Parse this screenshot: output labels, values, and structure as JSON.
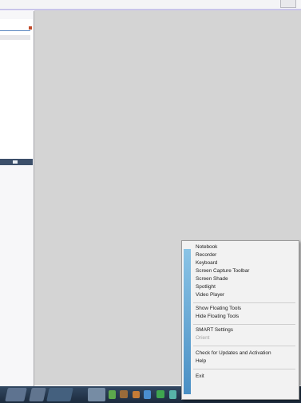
{
  "menu": {
    "group1": [
      "Notebook",
      "Recorder",
      "Keyboard",
      "Screen Capture Toolbar",
      "Screen Shade",
      "Spotlight",
      "Video Player"
    ],
    "group2": [
      "Show Floating Tools",
      "Hide Floating Tools"
    ],
    "group3": [
      "SMART Settings",
      "Orient"
    ],
    "group4": [
      "Check for Updates and Activation",
      "Help"
    ],
    "group5": [
      "Exit"
    ]
  },
  "colors": {
    "workspace": "#d4d4d4",
    "menu_background": "#f2f2f2",
    "menu_stripe": "#4a8fc4",
    "taskbar": "#1c2b3d"
  }
}
